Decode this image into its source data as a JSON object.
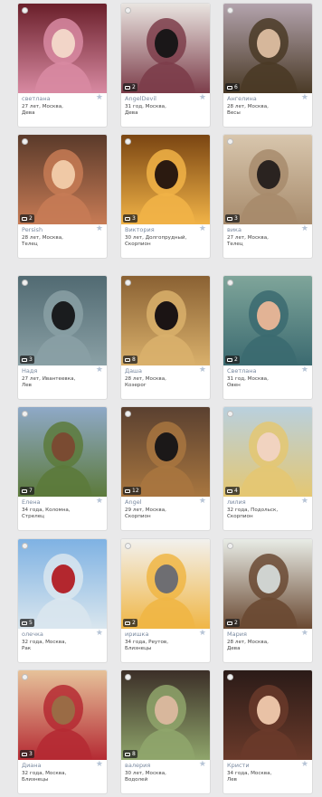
{
  "users": [
    {
      "name": "светлана",
      "details_line1": "27 лет, Москва,",
      "details_line2": "Дева",
      "photo_count": "",
      "palette": [
        "#6a1f2a",
        "#d88aa2",
        "#f2d5c8"
      ]
    },
    {
      "name": "AngelDevil",
      "details_line1": "31 год, Москва,",
      "details_line2": "Дева",
      "photo_count": "2",
      "palette": [
        "#e9e4e0",
        "#7c3d4a",
        "#1a1718"
      ]
    },
    {
      "name": "Ангелина",
      "details_line1": "28 лет, Москва,",
      "details_line2": "Весы",
      "photo_count": "6",
      "palette": [
        "#b3a3ad",
        "#4a3a26",
        "#d6b79b"
      ]
    },
    {
      "name": "Persish",
      "details_line1": "28 лет, Москва,",
      "details_line2": "Телец",
      "photo_count": "2",
      "palette": [
        "#5a3a2a",
        "#c77b55",
        "#f0c9a6"
      ]
    },
    {
      "name": "Виктория",
      "details_line1": "30 лет, Долгопрудный,",
      "details_line2": "Скорпион",
      "photo_count": "3",
      "palette": [
        "#7a4512",
        "#f1b347",
        "#2b1a10"
      ]
    },
    {
      "name": "вика",
      "details_line1": "27 лет, Москва,",
      "details_line2": "Телец",
      "photo_count": "3",
      "palette": [
        "#d8c6ad",
        "#a78b6c",
        "#2a2320"
      ]
    },
    {
      "name": "Надя",
      "details_line1": "27 лет, Ивантеевка,",
      "details_line2": "Лев",
      "photo_count": "3",
      "palette": [
        "#516a72",
        "#8aa0a5",
        "#1a1c1e"
      ]
    },
    {
      "name": "Даша",
      "details_line1": "28 лет, Москва,",
      "details_line2": "Козерог",
      "photo_count": "8",
      "palette": [
        "#8a6133",
        "#d9b06b",
        "#1b1414"
      ]
    },
    {
      "name": "Светлана",
      "details_line1": "31 год, Москва,",
      "details_line2": "Овен",
      "photo_count": "2",
      "palette": [
        "#7fa59a",
        "#3b6a70",
        "#e2b395"
      ]
    },
    {
      "name": "Елена",
      "details_line1": "34 года, Коломна,",
      "details_line2": "Стрелец",
      "photo_count": "7",
      "palette": [
        "#8fa9c8",
        "#5c7a3b",
        "#7a4b32"
      ]
    },
    {
      "name": "Angel",
      "details_line1": "29 лет, Москва,",
      "details_line2": "Скорпион",
      "photo_count": "12",
      "palette": [
        "#5a4030",
        "#a8763f",
        "#1b1818"
      ]
    },
    {
      "name": "лилия",
      "details_line1": "32 года, Подольск,",
      "details_line2": "Скорпион",
      "photo_count": "4",
      "palette": [
        "#b9d0de",
        "#e4c772",
        "#f1d3c0"
      ]
    },
    {
      "name": "олечка",
      "details_line1": "32 года, Москва,",
      "details_line2": "Рак",
      "photo_count": "5",
      "palette": [
        "#7fb2e3",
        "#d9e6ee",
        "#b3272e"
      ]
    },
    {
      "name": "иришка",
      "details_line1": "34 года, Реутов,",
      "details_line2": "Близнецы",
      "photo_count": "2",
      "palette": [
        "#f2f1ee",
        "#f0b645",
        "#6e6e72"
      ]
    },
    {
      "name": "Мария",
      "details_line1": "28 лет, Москва,",
      "details_line2": "Дева",
      "photo_count": "2",
      "palette": [
        "#e8ece6",
        "#6a4932",
        "#cfd3d0"
      ]
    },
    {
      "name": "Диана",
      "details_line1": "32 года, Москва,",
      "details_line2": "Близнецы",
      "photo_count": "3",
      "palette": [
        "#e6c29a",
        "#b52a33",
        "#9a6b45"
      ]
    },
    {
      "name": "валерия",
      "details_line1": "30 лет, Москва,",
      "details_line2": "Водолей",
      "photo_count": "8",
      "palette": [
        "#3c2f28",
        "#8fa56b",
        "#d8b79c"
      ]
    },
    {
      "name": "Кристи",
      "details_line1": "34 года, Москва,",
      "details_line2": "Лев",
      "photo_count": "",
      "palette": [
        "#2b1b18",
        "#6a3a2a",
        "#e9c2a6"
      ]
    }
  ],
  "ui": {
    "favorite_icon": "star-icon",
    "photo_icon": "camera-icon",
    "online_icon": "status-dot-icon"
  }
}
